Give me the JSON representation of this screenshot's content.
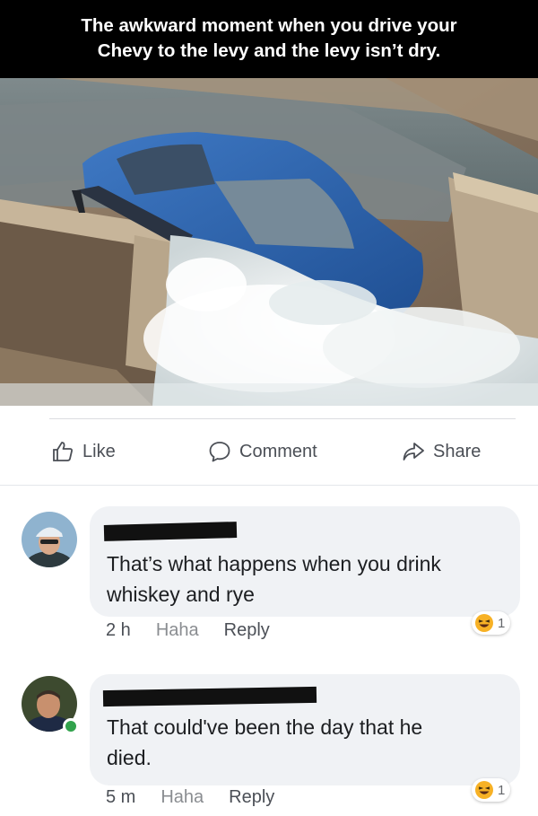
{
  "caption": {
    "line1": "The awkward moment when you drive your",
    "line2": "Chevy to the levy and the levy isn’t dry."
  },
  "photo": {
    "subject": "blue car sliding down a flooded canal spillway"
  },
  "actions": {
    "like": "Like",
    "comment": "Comment",
    "share": "Share"
  },
  "comments": [
    {
      "text_line1": "That’s what happens when you drink",
      "text_line2": "whiskey and rye",
      "time": "2 h",
      "haha": "Haha",
      "reply": "Reply",
      "reaction_count": "1"
    },
    {
      "text_line1": "That could've been the day that he",
      "text_line2": "died.",
      "time": "5 m",
      "haha": "Haha",
      "reply": "Reply",
      "reaction_count": "1"
    }
  ],
  "colors": {
    "online": "#31a24c",
    "bubble": "#f0f2f5",
    "caption_bg": "#000000"
  },
  "icons": [
    "like-icon",
    "comment-icon",
    "share-icon",
    "haha-reaction-icon"
  ]
}
